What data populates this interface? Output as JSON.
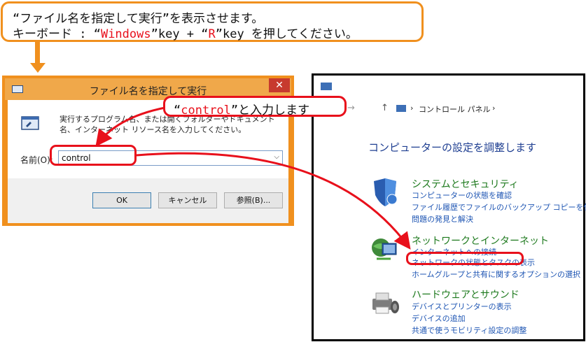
{
  "instruction": {
    "line1": "“ファイル名を指定して実行”を表示させます。",
    "line2_pre": "キーボード : “",
    "line2_key1": "Windows",
    "line2_mid": "”key + “",
    "line2_key2": "R",
    "line2_post": "”key を押してください。"
  },
  "run_dialog": {
    "title": "ファイル名を指定して実行",
    "close_label": "✕",
    "description": "実行するプログラム名、または開くフォルダーやドキュメント名、インターネット リソース名を入力してください。",
    "name_label": "名前(O):",
    "input_value": "control",
    "ok_label": "OK",
    "cancel_label": "キャンセル",
    "browse_label": "参照(B)..."
  },
  "annotation": {
    "pre": "“",
    "code": "control",
    "post": "”と入力します"
  },
  "control_panel": {
    "breadcrumb": [
      "コントロール パネル"
    ],
    "heading": "コンピューターの設定を調整します",
    "categories": [
      {
        "title": "システムとセキュリティ",
        "links": [
          "コンピューターの状態を確認",
          "ファイル履歴でファイルのバックアップ コピーを保存",
          "問題の発見と解決"
        ]
      },
      {
        "title": "ネットワークとインターネット",
        "links": [
          "インターネットへの接続",
          "ネットワークの状態とタスクの表示",
          "ホームグループと共有に関するオプションの選択"
        ]
      },
      {
        "title": "ハードウェアとサウンド",
        "links": [
          "デバイスとプリンターの表示",
          "デバイスの追加",
          "共通で使うモビリティ設定の調整"
        ]
      }
    ]
  },
  "colors": {
    "callout_orange": "#f0901e",
    "highlight_red": "#e8101b",
    "link_blue": "#1e55b3",
    "category_green": "#1e7a1e"
  }
}
